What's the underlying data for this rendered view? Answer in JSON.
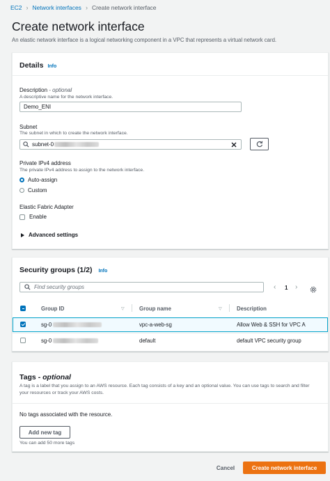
{
  "breadcrumb": {
    "ec2": "EC2",
    "network_interfaces": "Network interfaces",
    "current": "Create network interface"
  },
  "page": {
    "title": "Create network interface",
    "description": "An elastic network interface is a logical networking component in a VPC that represents a virtual network card."
  },
  "details": {
    "title": "Details",
    "info": "Info",
    "description_label": "Description",
    "description_optional": "- optional",
    "description_hint": "A descriptive name for the network interface.",
    "description_value": "Demo_ENI",
    "subnet_label": "Subnet",
    "subnet_hint": "The subnet in which to create the network interface.",
    "subnet_value_prefix": "subnet-0",
    "ipv4_label": "Private IPv4 address",
    "ipv4_hint": "The private IPv4 address to assign to the network interface.",
    "ipv4_options": [
      "Auto-assign",
      "Custom"
    ],
    "ipv4_selected": "Auto-assign",
    "efa_label": "Elastic Fabric Adapter",
    "efa_option": "Enable",
    "advanced": "Advanced settings"
  },
  "security_groups": {
    "title": "Security groups (1/2)",
    "info": "Info",
    "search_placeholder": "Find security groups",
    "page": "1",
    "columns": [
      "Group ID",
      "Group name",
      "Description"
    ],
    "rows": [
      {
        "id_prefix": "sg-0",
        "name": "vpc-a-web-sg",
        "description": "Allow Web & SSH for VPC A",
        "selected": true
      },
      {
        "id_prefix": "sg-0",
        "name": "default",
        "description": "default VPC security group",
        "selected": false
      }
    ]
  },
  "tags": {
    "title": "Tags",
    "optional": "- optional",
    "description": "A tag is a label that you assign to an AWS resource. Each tag consists of a key and an optional value. You can use tags to search and filter your resources or track your AWS costs.",
    "empty": "No tags associated with the resource.",
    "add_button": "Add new tag",
    "limit": "You can add 50 more tags"
  },
  "footer": {
    "cancel": "Cancel",
    "create": "Create network interface"
  },
  "colors": {
    "accent": "#0073bb",
    "primary": "#ec7211",
    "selected_row": "#f1faff"
  }
}
